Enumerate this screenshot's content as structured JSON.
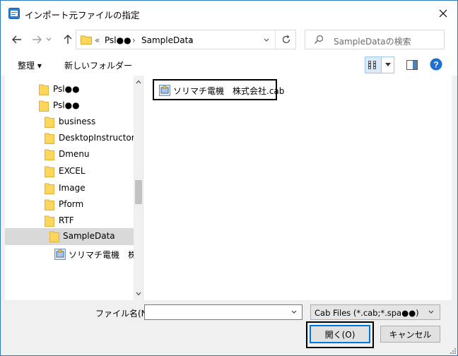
{
  "window": {
    "title": "インポート元ファイルの指定",
    "close_label": "✕"
  },
  "nav": {
    "back_icon": "arrow-left-icon",
    "forward_icon": "arrow-right-icon",
    "up_icon": "arrow-up-icon",
    "breadcrumb_overflow": "«",
    "breadcrumb": [
      "Psl●●",
      "SampleData"
    ],
    "separator": "›",
    "search_placeholder": "SampleDataの検索"
  },
  "toolbar": {
    "organize_label": "整理 ▾",
    "new_folder_label": "新しいフォルダー"
  },
  "tree": {
    "items": [
      {
        "label": "Psl●●",
        "level": 0,
        "type": "folder"
      },
      {
        "label": "Psl●●",
        "level": 0,
        "type": "folder"
      },
      {
        "label": "business",
        "level": 1,
        "type": "folder"
      },
      {
        "label": "DesktopInstructor",
        "level": 1,
        "type": "folder"
      },
      {
        "label": "Dmenu",
        "level": 1,
        "type": "folder"
      },
      {
        "label": "EXCEL",
        "level": 1,
        "type": "folder"
      },
      {
        "label": "Image",
        "level": 1,
        "type": "folder"
      },
      {
        "label": "Pform",
        "level": 1,
        "type": "folder"
      },
      {
        "label": "RTF",
        "level": 1,
        "type": "folder"
      },
      {
        "label": "SampleData",
        "level": 2,
        "type": "folder",
        "selected": true
      },
      {
        "label": "ソリマチ電機　株式",
        "level": 3,
        "type": "cab"
      }
    ]
  },
  "files": [
    {
      "name": "ソリマチ電機　株式会社.cab"
    }
  ],
  "bottom": {
    "filename_label": "ファイル名(N):",
    "filename_value": "",
    "filetype_value": "Cab Files (*.cab;*.spa●●)",
    "open_label": "開く(O)",
    "cancel_label": "キャンセル"
  },
  "colors": {
    "accent": "#0078d7",
    "folder": "#ffd65c",
    "selected_bg": "#d9d9d9"
  }
}
